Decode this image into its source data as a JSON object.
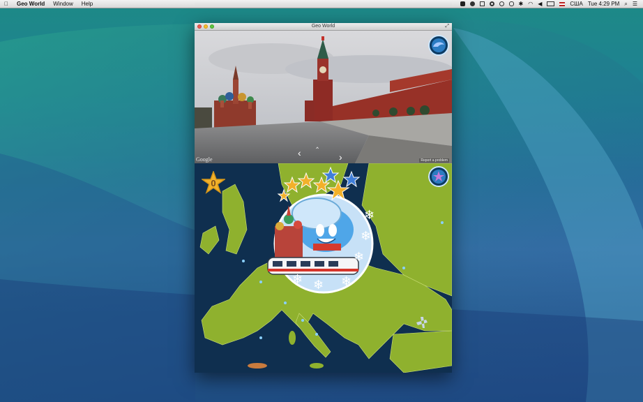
{
  "menubar": {
    "app_name": "Geo World",
    "menus": [
      "Window",
      "Help"
    ],
    "input_source": "США",
    "clock": "Tue 4:29 PM"
  },
  "window": {
    "title": "Geo World"
  },
  "streetview": {
    "provider_label": "Google",
    "report_label": "Report a problem"
  },
  "game": {
    "score": "0"
  },
  "colors": {
    "map_sea": "#0f2f4f",
    "land": "#8fb12e",
    "star": "#f2b12a"
  }
}
